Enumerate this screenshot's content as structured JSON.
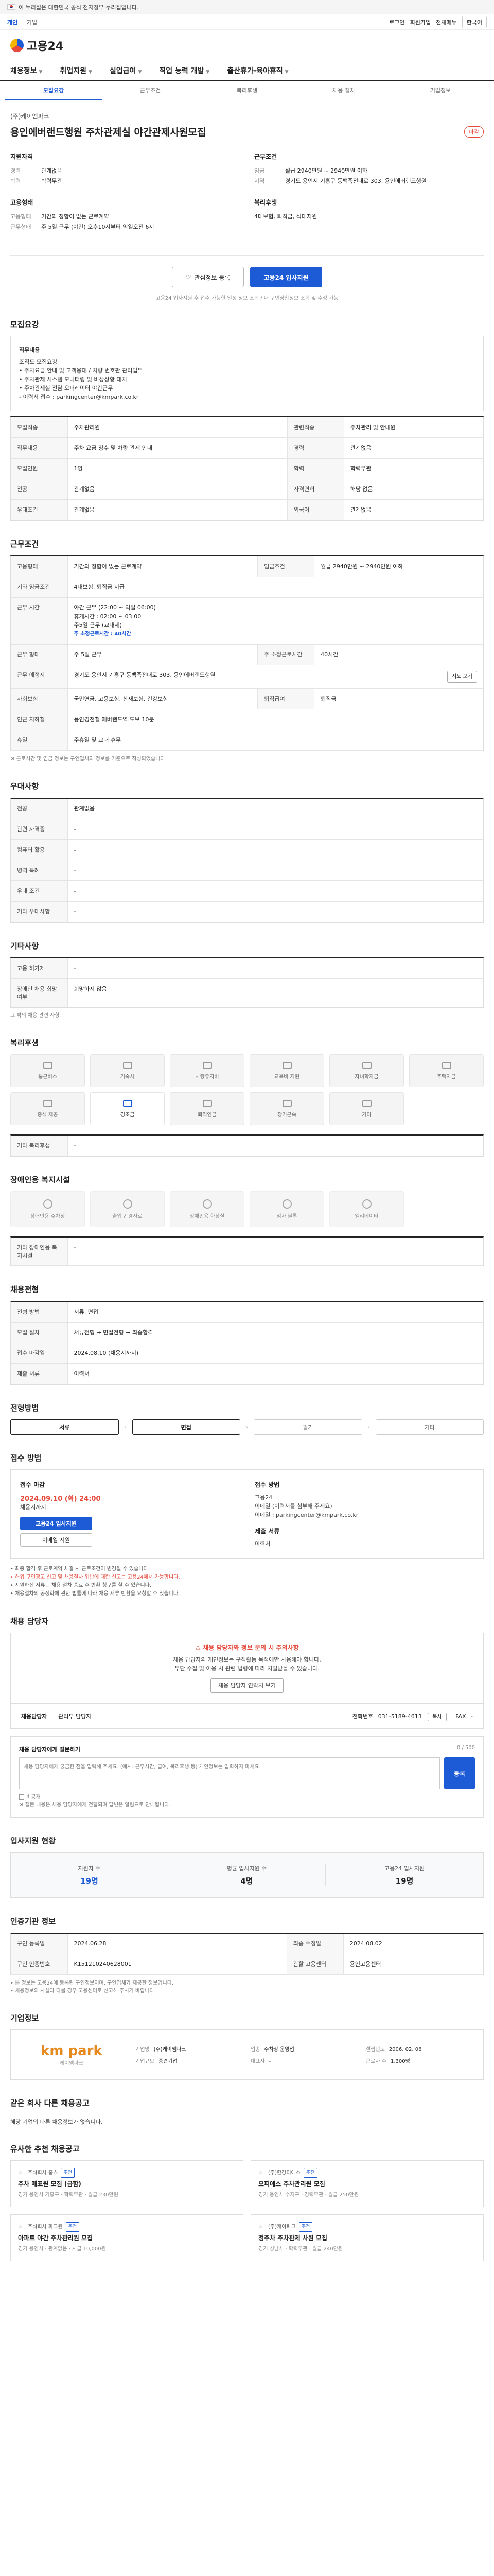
{
  "gov_bar": {
    "text": "이 누리집은 대한민국 공식 전자정부 누리집입니다."
  },
  "util": {
    "links": [
      "개인",
      "기업"
    ],
    "right": [
      "로그인",
      "회원가입",
      "전체메뉴"
    ],
    "lang": "한국어"
  },
  "header": {
    "logo": "고용24"
  },
  "gnb": [
    "채용정보",
    "취업지원",
    "실업급여",
    "직업 능력 개발",
    "출산휴가·육아휴직"
  ],
  "tabs": [
    "모집요강",
    "근무조건",
    "복리후생",
    "채용 절차",
    "기업정보"
  ],
  "job": {
    "company": "(주)케이엠파크",
    "title": "용인에버랜드행원 주차관제실 야간관제사원모집",
    "deadline_badge": "마감",
    "summary": {
      "qual_title": "지원자격",
      "qual": [
        {
          "k": "경력",
          "v": "관계없음"
        },
        {
          "k": "학력",
          "v": "학력무관"
        }
      ],
      "cond_title": "근무조건",
      "cond": [
        {
          "k": "임금",
          "v": "월급 2940만원 ~ 2940만원 이하"
        },
        {
          "k": "지역",
          "v": "경기도 용인시 기흥구 동백죽전대로 303, 용인에버랜드행원"
        }
      ],
      "type_title": "고용형태",
      "type": [
        {
          "k": "고용형태",
          "v": "기간의 정함이 없는 근로계약"
        },
        {
          "k": "근무형태",
          "v": "주 5일 근무 (야간) 오후10시부터 익일오전 6시"
        }
      ],
      "welfare_title": "복리후생",
      "welfare": "4대보험, 퇴직금, 식대지원"
    },
    "btn_interest": "관심정보 등록",
    "btn_apply": "고용24 입사지원",
    "btn_note": "고용24 입사지원 후 접수 가능한 일정 정보 조회 / 내 구인상황정보 조회 및 수정 가능"
  },
  "recruit": {
    "title": "모집요강",
    "desc_head": "직무내용",
    "desc_lines": [
      "직무내용",
      "조직도 모집요강",
      "• 주차요금 안내 및 고객응대 / 차량 번호판 관리업무",
      "• 주차관제 시스템 모니터링 및 비상상황 대처",
      "• 주차관제실 전담 오퍼레이터 야간근무",
      "  - 이력서 접수 : parkingcenter@kmpark.co.kr"
    ],
    "rows": [
      {
        "k": "모집직종",
        "v": "주차관리원",
        "k2": "관련직종",
        "v2": "주차관리 및 안내원"
      },
      {
        "k": "직무내용",
        "v": "주차 요금 징수 및 차량 관제 안내",
        "k2": "경력",
        "v2": "관계없음"
      },
      {
        "k": "모집인원",
        "v": "1명",
        "k2": "학력",
        "v2": "학력무관"
      },
      {
        "k": "전공",
        "v": "관계없음",
        "k2": "자격면허",
        "v2": "해당 없음"
      },
      {
        "k": "우대조건",
        "v": "관계없음",
        "k2": "외국어",
        "v2": "관계없음"
      }
    ]
  },
  "work": {
    "title": "근무조건",
    "employ_type": "기간의 정함이 없는 근로계약",
    "salary": "월급 2940만원 ~ 2940만원 이하",
    "salary_label": "임금조건",
    "etc_label": "기타 임금조건",
    "etc": "4대보험, 퇴직금 지급",
    "hours_label": "근무 시간",
    "hours_lines": [
      "야간 근무 (22:00 ~ 익일 06:00)",
      "휴게시간 : 02:00 ~ 03:00",
      "주5일 근무 (교대제)"
    ],
    "hours_note": "주 소정근로시간 : 40시간",
    "shift_label": "근무 형태",
    "shift": "주 5일 근무",
    "week_hours_label": "주 소정근로시간",
    "week_hours": "40시간",
    "location_label": "근무 예정지",
    "location": "경기도 용인시 기흥구 동백죽전대로 303, 용인에버랜드행원",
    "map_btn": "지도 보기",
    "insurance_label": "사회보험",
    "insurance": "국민연금, 고용보험, 산재보험, 건강보험",
    "severance_label": "퇴직급여",
    "severance": "퇴직금",
    "station_label": "인근 지하철",
    "station": "용인경전철 에버랜드역 도보 10분",
    "holiday_label": "휴일",
    "holiday": "주휴일 및 교대 휴무",
    "note": "※ 근로시간 및 임금 정보는 구인업체의 정보를 기준으로 작성되었습니다."
  },
  "prefer": {
    "title": "우대사항",
    "rows": [
      {
        "k": "전공",
        "v": "관계없음"
      },
      {
        "k": "관련 자격증",
        "v": "-"
      },
      {
        "k": "컴퓨터 활용",
        "v": "-"
      },
      {
        "k": "병역 특례",
        "v": "-"
      },
      {
        "k": "우대 조건",
        "v": "-"
      },
      {
        "k": "기타 우대사항",
        "v": "-"
      }
    ]
  },
  "other": {
    "title": "기타사항",
    "rows": [
      {
        "k": "고용 허가제",
        "v": "-"
      },
      {
        "k": "장애인 채용 희망 여부",
        "v": "희망하지 않음"
      }
    ],
    "note": "그 밖의 채용 관련 사항"
  },
  "welfare": {
    "title": "복리후생",
    "items": [
      {
        "label": "통근버스",
        "on": false
      },
      {
        "label": "기숙사",
        "on": false
      },
      {
        "label": "차량유지비",
        "on": false
      },
      {
        "label": "교육비 지원",
        "on": false
      },
      {
        "label": "자녀학자금",
        "on": false
      },
      {
        "label": "주택자금",
        "on": false
      },
      {
        "label": "중식 제공",
        "on": false
      },
      {
        "label": "경조금",
        "on": true
      },
      {
        "label": "퇴직연금",
        "on": false
      },
      {
        "label": "장기근속",
        "on": false
      },
      {
        "label": "기타",
        "on": false
      }
    ],
    "etc_label": "기타 복리후생",
    "etc": "-"
  },
  "disability": {
    "title": "장애인용 복지시설",
    "items": [
      "장애인용 주차장",
      "출입구 경사로",
      "장애인용 화장실",
      "점자 블록",
      "엘리베이터"
    ],
    "etc_label": "기타 장애인용 복지시설",
    "etc": "-"
  },
  "process": {
    "title": "채용전형",
    "rows": [
      {
        "k": "전형 방법",
        "v": "서류, 면접"
      },
      {
        "k": "모집 절차",
        "v": "서류전형 → 면접전형 → 최종합격"
      },
      {
        "k": "접수 마감일",
        "v": "2024.08.10 (채용시까지)"
      },
      {
        "k": "제출 서류",
        "v": "이력서"
      }
    ]
  },
  "steps": {
    "title": "전형방법",
    "items": [
      "서류",
      "면접",
      "필기",
      "기타"
    ],
    "active": [
      true,
      true,
      false,
      false
    ]
  },
  "apply": {
    "title": "접수 방법",
    "left_title": "접수 마감",
    "left_big": "2024.09.10 (화) 24:00",
    "left_sub": "채용시까지",
    "right_title": "접수 방법",
    "right_lines": [
      "고용24",
      "이메일 (이력서를 첨부해 주세요)",
      "이메일 : parkingcenter@kmpark.co.kr"
    ],
    "right_title2": "제출 서류",
    "right_doc": "이력서",
    "btn_apply": "고용24 입사지원",
    "btn_email": "이메일 지원",
    "notices": [
      "• 최종 합격 후 근로계약 체결 시 근로조건이 변경될 수 있습니다.",
      "• 허위 구인광고 신고 및 채용절차 위반에 대한 신고는 고용24에서 가능합니다.",
      "• 지원하신 서류는 채용 절차 종료 후 반환 청구를 할 수 있습니다.",
      "• 채용절차의 공정화에 관한 법률에 따라 채용 서류 반환을 요청할 수 있습니다."
    ]
  },
  "manager": {
    "title": "채용 담당자",
    "warn": "채용 담당자와 정보 문의 시 주의사항",
    "lines": [
      "채용 담당자의 개인정보는 구직활동 목적에만 사용해야 합니다.",
      "무단 수집 및 이용 시 관련 법령에 따라 처벌받을 수 있습니다."
    ],
    "btn": "채용 담당자 연락처 보기",
    "card_label": "채용담당자",
    "card_name": "관리부 담당자",
    "phone_label": "전화번호",
    "phone": "031-5189-4613",
    "fax_label": "FAX",
    "fax": "-",
    "phone_btn": "복사"
  },
  "qa": {
    "title": "채용 담당자에게 질문하기",
    "count": "0 / 500",
    "placeholder": "채용 담당자에게 궁금한 점을 입력해 주세요. (예시: 근무시간, 급여, 복리후생 등) 개인정보는 입력하지 마세요.",
    "send": "등록",
    "foot": "※ 질문 내용은 채용 담당자에게 전달되며 답변은 알림으로 안내됩니다.",
    "secret": "비공개"
  },
  "stats": {
    "title": "입사지원 현황",
    "items": [
      {
        "label": "지원자 수",
        "value": "19명",
        "blue": true
      },
      {
        "label": "평균 입사지원 수",
        "value": "4명",
        "blue": false
      },
      {
        "label": "고용24 입사지원",
        "value": "19명",
        "blue": false
      }
    ]
  },
  "info": {
    "title": "인증기관 정보",
    "rows": [
      {
        "k": "구인 등록일",
        "v": "2024.06.28",
        "k2": "최종 수정일",
        "v2": "2024.08.02"
      },
      {
        "k": "구인 인증번호",
        "v": "K151210240628001",
        "k2": "관할 고용센터",
        "v2": "용인고용센터"
      }
    ],
    "notes": [
      "• 본 정보는 고용24에 등록된 구인정보이며, 구인업체가 제공한 정보입니다.",
      "• 채용정보의 사실과 다를 경우 고용센터로 신고해 주시기 바랍니다."
    ]
  },
  "company": {
    "title": "기업정보",
    "logo": "km park",
    "logo_sub": "케이엠파크",
    "fields": [
      {
        "k": "기업명",
        "v": "(주)케이엠파크"
      },
      {
        "k": "업종",
        "v": "주차장 운영업"
      },
      {
        "k": "설립년도",
        "v": "2006. 02. 06"
      },
      {
        "k": "기업규모",
        "v": "중견기업"
      },
      {
        "k": "대표자",
        "v": "-"
      },
      {
        "k": "근로자 수",
        "v": "1,300명"
      }
    ]
  },
  "related": {
    "title": "같은 회사 다른 채용공고",
    "empty": "해당 기업의 다른 채용정보가 없습니다."
  },
  "recommend": {
    "title": "유사한 추천 채용공고",
    "items": [
      {
        "company": "주식회사 홈스",
        "tag": "추천",
        "title": "주차 매표원 모집 (급함)",
        "meta": "경기 용인시 기흥구 · 학력무관 · 월급 230만원"
      },
      {
        "company": "(주)한강티에스",
        "tag": "추천",
        "title": "오피에스 주차관리원 모집",
        "meta": "경기 용인시 수지구 · 경력무관 · 월급 250만원"
      },
      {
        "company": "주식회사 파크원",
        "tag": "추천",
        "title": "아파트 야간 주차관리원 모집",
        "meta": "경기 용인시 · 관계없음 · 시급 10,000원"
      },
      {
        "company": "(주)케이파크",
        "tag": "추천",
        "title": "정주차 주차관제 사원 모집",
        "meta": "경기 성남시 · 학력무관 · 월급 240만원"
      }
    ]
  }
}
